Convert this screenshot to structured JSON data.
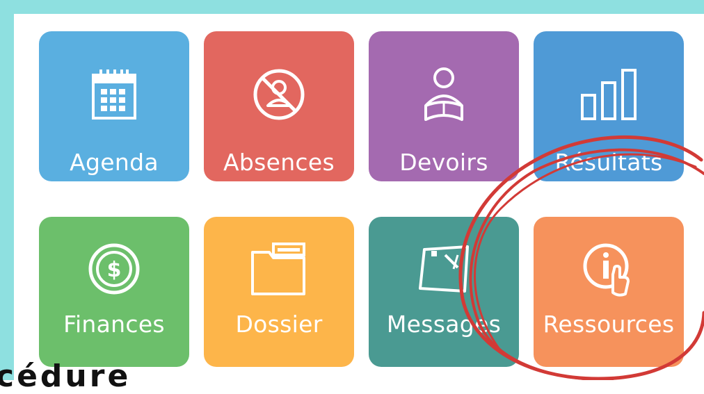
{
  "colors": {
    "frame": "#8ee0e0",
    "agenda": "#5aafe0",
    "absences": "#e2675f",
    "devoirs": "#a46ab0",
    "resultats": "#4f9ad6",
    "finances": "#6cbf6b",
    "dossier": "#fdb54a",
    "messages": "#4a9a92",
    "ressources": "#f6925c",
    "annotation": "#d23a36"
  },
  "tiles": [
    {
      "key": "agenda",
      "label": "Agenda",
      "icon": "calendar-icon"
    },
    {
      "key": "absences",
      "label": "Absences",
      "icon": "no-person-icon"
    },
    {
      "key": "devoirs",
      "label": "Devoirs",
      "icon": "student-reading-icon"
    },
    {
      "key": "resultats",
      "label": "Résultats",
      "icon": "bar-chart-icon"
    },
    {
      "key": "finances",
      "label": "Finances",
      "icon": "dollar-coin-icon"
    },
    {
      "key": "dossier",
      "label": "Dossier",
      "icon": "folder-icon"
    },
    {
      "key": "messages",
      "label": "Messages",
      "icon": "message-board-icon"
    },
    {
      "key": "ressources",
      "label": "Ressources",
      "icon": "info-hand-icon"
    }
  ],
  "partial_text": "cédure"
}
